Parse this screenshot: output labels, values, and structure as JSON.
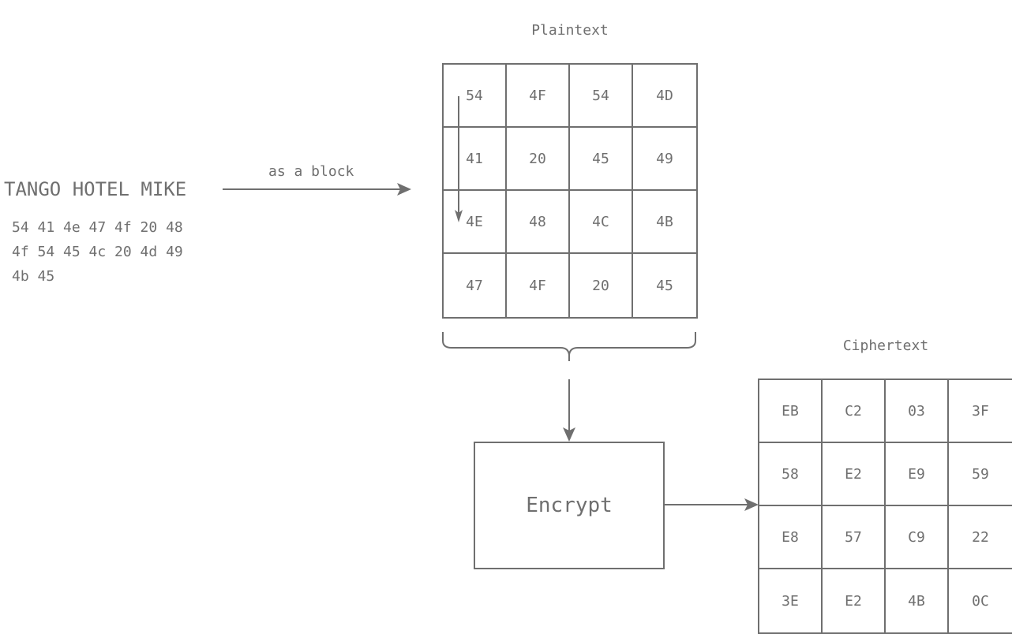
{
  "input": {
    "text": "TANGO HOTEL MIKE",
    "hex_lines": [
      "54 41 4e 47 4f 20 48",
      "4f 54 45 4c 20 4d 49",
      "4b 45"
    ]
  },
  "arrow_label": "as a block",
  "plaintext": {
    "title": "Plaintext",
    "rows": [
      [
        "54",
        "4F",
        "54",
        "4D"
      ],
      [
        "41",
        "20",
        "45",
        "49"
      ],
      [
        "4E",
        "48",
        "4C",
        "4B"
      ],
      [
        "47",
        "4F",
        "20",
        "45"
      ]
    ]
  },
  "process": {
    "label": "Encrypt"
  },
  "ciphertext": {
    "title": "Ciphertext",
    "rows": [
      [
        "EB",
        "C2",
        "03",
        "3F"
      ],
      [
        "58",
        "E2",
        "E9",
        "59"
      ],
      [
        "E8",
        "57",
        "C9",
        "22"
      ],
      [
        "3E",
        "E2",
        "4B",
        "0C"
      ]
    ]
  },
  "colors": {
    "stroke": "#6f6f6f",
    "background": "#ffffff"
  }
}
